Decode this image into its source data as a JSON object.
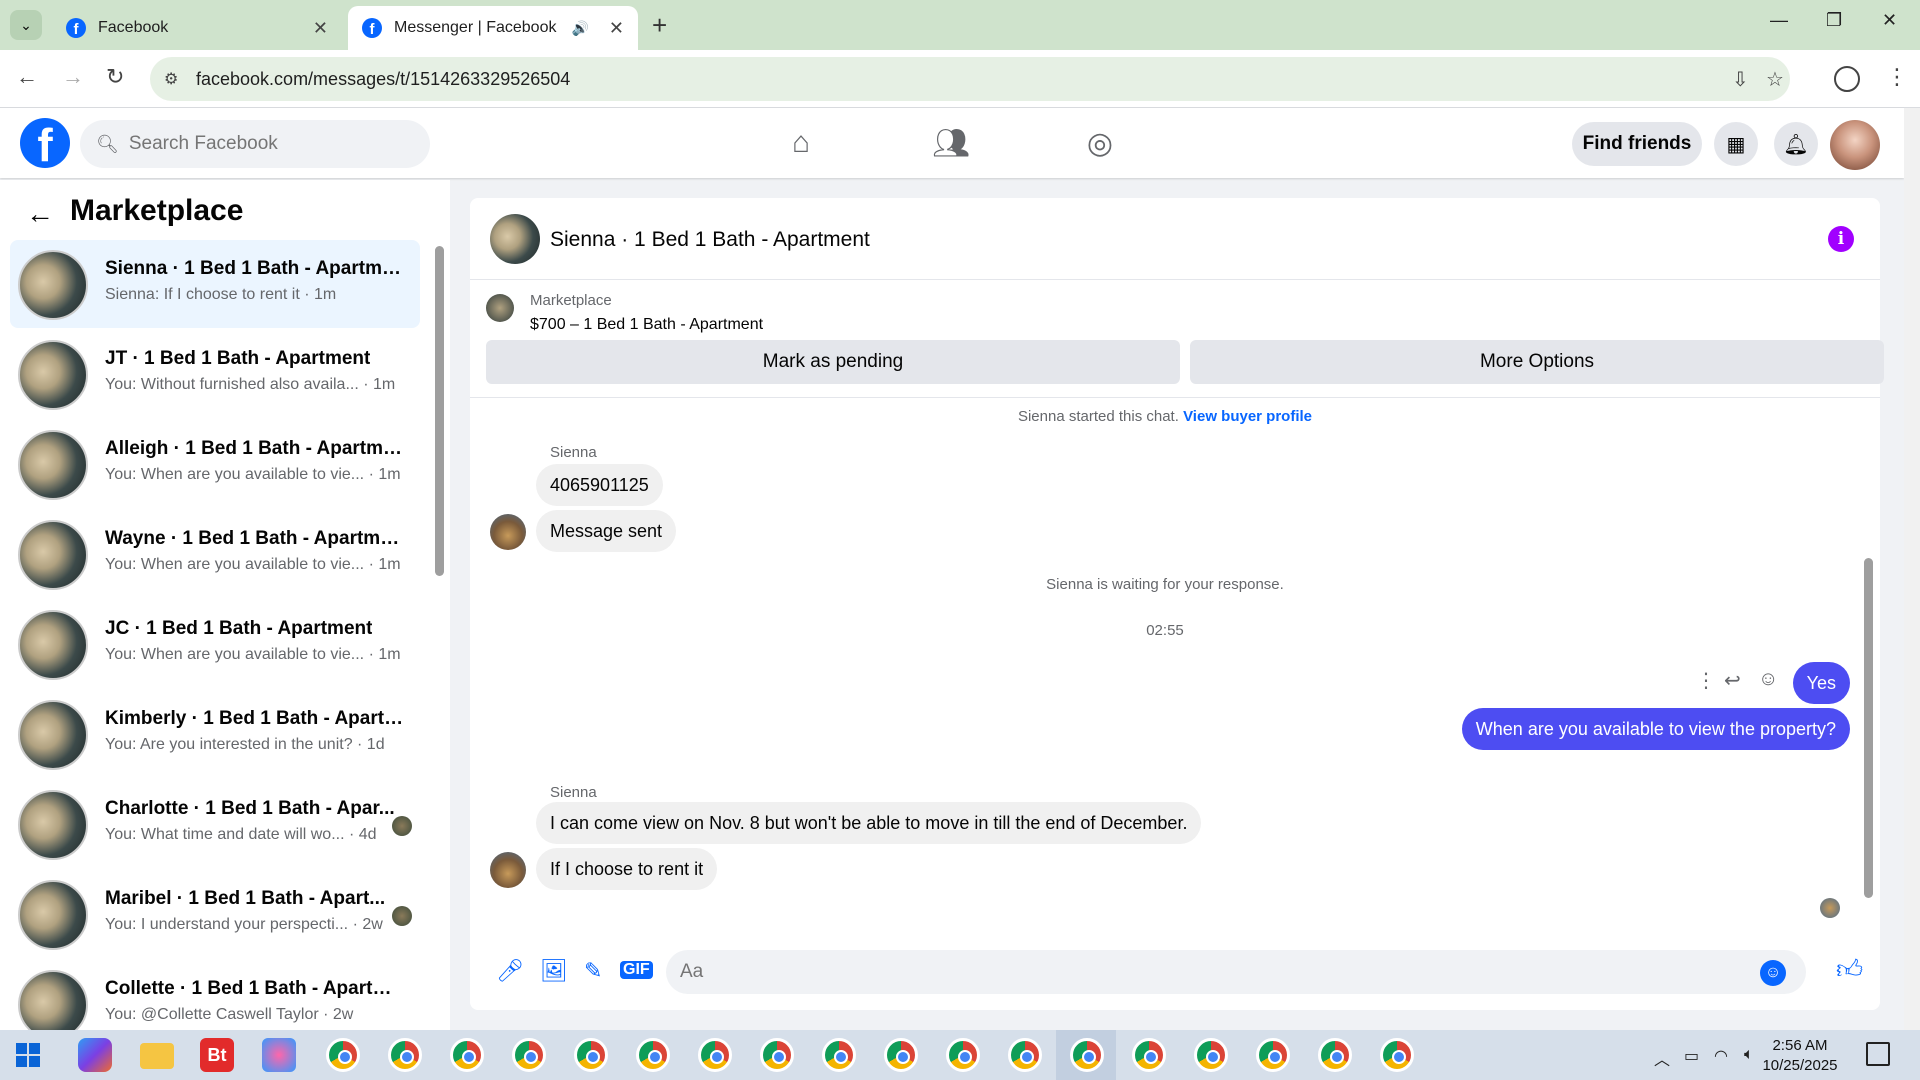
{
  "browser": {
    "tabs": [
      {
        "title": "Facebook"
      },
      {
        "title": "Messenger | Facebook"
      }
    ],
    "url": "facebook.com/messages/t/1514263329526504"
  },
  "fb_header": {
    "search_placeholder": "Search Facebook",
    "find_friends": "Find friends"
  },
  "sidebar": {
    "title": "Marketplace",
    "conversations": [
      {
        "name": "Sienna · 1 Bed 1 Bath - Apartment",
        "preview": "Sienna: If I choose to rent it · 1m"
      },
      {
        "name": "JT · 1 Bed 1 Bath - Apartment",
        "preview": "You: Without furnished also availa... · 1m"
      },
      {
        "name": "Alleigh · 1 Bed 1 Bath - Apartment",
        "preview": "You: When are you available to vie... · 1m"
      },
      {
        "name": "Wayne · 1 Bed 1 Bath - Apartment",
        "preview": "You: When are you available to vie... · 1m"
      },
      {
        "name": "JC · 1 Bed 1 Bath - Apartment",
        "preview": "You: When are you available to vie... · 1m"
      },
      {
        "name": "Kimberly · 1 Bed 1 Bath - Apartm...",
        "preview": "You: Are you interested in the unit? · 1d"
      },
      {
        "name": "Charlotte · 1 Bed 1 Bath - Apar...",
        "preview": "You: What time and date will wo... · 4d"
      },
      {
        "name": "Maribel · 1 Bed 1 Bath - Apart...",
        "preview": "You: I understand your perspecti... · 2w"
      },
      {
        "name": "Collette · 1 Bed 1 Bath - Apartme...",
        "preview": "You: @Collette Caswell Taylor · 2w"
      }
    ]
  },
  "chat": {
    "title": "Sienna · 1 Bed 1 Bath - Apartment",
    "marketplace_label": "Marketplace",
    "listing": "$700 – 1 Bed 1 Bath - Apartment",
    "mark_pending": "Mark as pending",
    "more_options": "More Options",
    "started_text": "Sienna started this chat.",
    "view_profile": "View buyer profile",
    "sender_name": "Sienna",
    "msg1": "4065901125",
    "msg2": "Message sent",
    "waiting": "Sienna is waiting for your response.",
    "time": "02:55",
    "out1": "Yes",
    "out2": "When are you available to view the property?",
    "msg3": "I can come view on Nov. 8 but won't be able to move in till the end of December.",
    "msg4": "If I choose to rent it",
    "composer_placeholder": "Aa"
  },
  "taskbar": {
    "time": "2:56 AM",
    "date": "10/25/2025"
  },
  "colors": {
    "fb_blue": "#0866ff",
    "outgoing_bubble": "#4d4df2",
    "info_purple": "#a100ff"
  }
}
